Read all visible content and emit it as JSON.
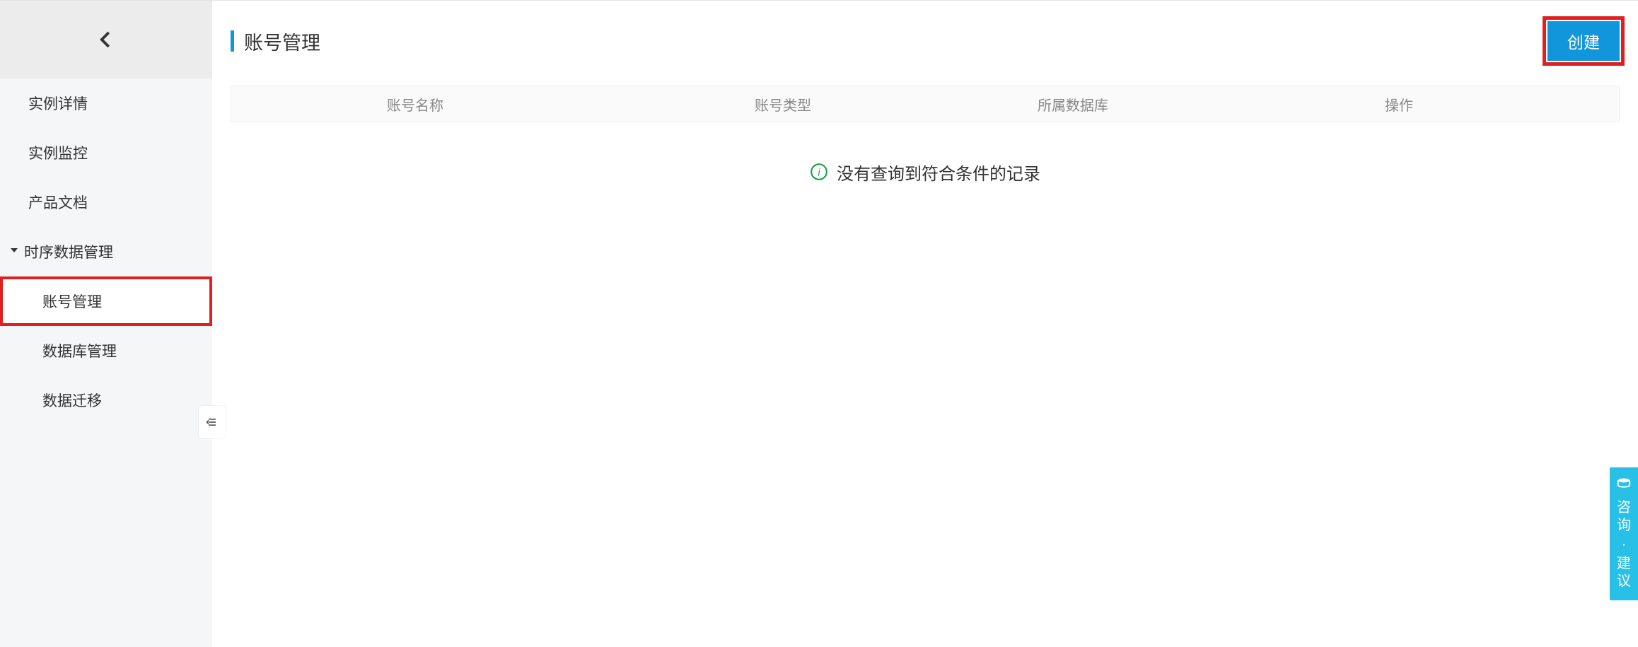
{
  "sidebar": {
    "back_aria": "返回",
    "items": [
      {
        "label": "实例详情"
      },
      {
        "label": "实例监控"
      },
      {
        "label": "产品文档"
      }
    ],
    "group": {
      "label": "时序数据管理",
      "children": [
        {
          "label": "账号管理",
          "active": true
        },
        {
          "label": "数据库管理"
        },
        {
          "label": "数据迁移"
        }
      ]
    }
  },
  "main": {
    "title": "账号管理",
    "create_label": "创建",
    "columns": {
      "name": "账号名称",
      "type": "账号类型",
      "db": "所属数据库",
      "op": "操作"
    },
    "empty_text": "没有查询到符合条件的记录"
  },
  "feedback": {
    "l1": "咨",
    "l2": "询",
    "dot": "·",
    "l3": "建",
    "l4": "议"
  },
  "colors": {
    "accent": "#1296db",
    "highlight": "#e02020",
    "sidebar_bg": "#f5f6f7",
    "feedback_bg": "#29c0e7"
  }
}
